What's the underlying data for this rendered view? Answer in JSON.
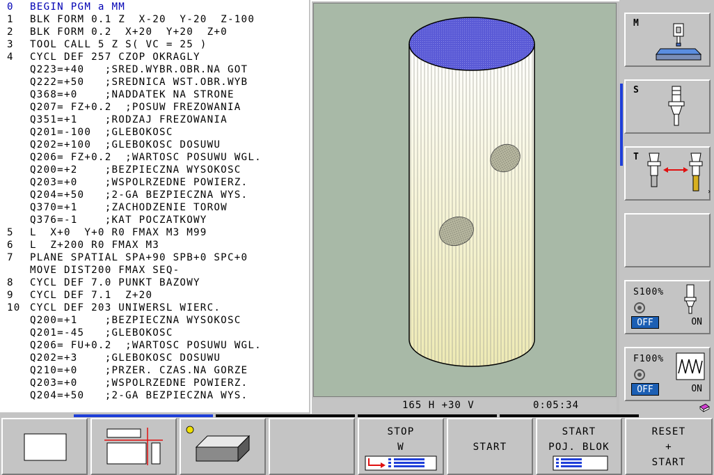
{
  "program": {
    "lines": [
      {
        "num": "0",
        "text": "BEGIN PGM a MM",
        "active": true
      },
      {
        "num": "1",
        "text": "BLK FORM 0.1 Z  X-20  Y-20  Z-100"
      },
      {
        "num": "2",
        "text": "BLK FORM 0.2  X+20  Y+20  Z+0"
      },
      {
        "num": "3",
        "text": "TOOL CALL 5 Z S( VC = 25 )"
      },
      {
        "num": "4",
        "text": "CYCL DEF 257 CZOP OKRAGLY"
      },
      {
        "num": "",
        "text": "Q223=+40   ;SRED.WYBR.OBR.NA GOT"
      },
      {
        "num": "",
        "text": "Q222=+50   ;SREDNICA WST.OBR.WYB"
      },
      {
        "num": "",
        "text": "Q368=+0    ;NADDATEK NA STRONE"
      },
      {
        "num": "",
        "text": "Q207= FZ+0.2  ;POSUW FREZOWANIA"
      },
      {
        "num": "",
        "text": "Q351=+1    ;RODZAJ FREZOWANIA"
      },
      {
        "num": "",
        "text": "Q201=-100  ;GLEBOKOSC"
      },
      {
        "num": "",
        "text": "Q202=+100  ;GLEBOKOSC DOSUWU"
      },
      {
        "num": "",
        "text": "Q206= FZ+0.2  ;WARTOSC POSUWU WGL."
      },
      {
        "num": "",
        "text": "Q200=+2    ;BEZPIECZNA WYSOKOSC"
      },
      {
        "num": "",
        "text": "Q203=+0    ;WSPOLRZEDNE POWIERZ."
      },
      {
        "num": "",
        "text": "Q204=+50   ;2-GA BEZPIECZNA WYS."
      },
      {
        "num": "",
        "text": "Q370=+1    ;ZACHODZENIE TOROW"
      },
      {
        "num": "",
        "text": "Q376=-1    ;KAT POCZATKOWY"
      },
      {
        "num": "5",
        "text": "L  X+0  Y+0 R0 FMAX M3 M99"
      },
      {
        "num": "6",
        "text": "L  Z+200 R0 FMAX M3"
      },
      {
        "num": "7",
        "text": "PLANE SPATIAL SPA+90 SPB+0 SPC+0"
      },
      {
        "num": "",
        "text": "MOVE DIST200 FMAX SEQ-"
      },
      {
        "num": "8",
        "text": "CYCL DEF 7.0 PUNKT BAZOWY"
      },
      {
        "num": "9",
        "text": "CYCL DEF 7.1  Z+20"
      },
      {
        "num": "10",
        "text": "CYCL DEF 203 UNIWERSL WIERC."
      },
      {
        "num": "",
        "text": "Q200=+1    ;BEZPIECZNA WYSOKOSC"
      },
      {
        "num": "",
        "text": "Q201=-45   ;GLEBOKOSC"
      },
      {
        "num": "",
        "text": "Q206= FU+0.2  ;WARTOSC POSUWU WGL."
      },
      {
        "num": "",
        "text": "Q202=+3    ;GLEBOKOSC DOSUWU"
      },
      {
        "num": "",
        "text": "Q210=+0    ;PRZER. CZAS.NA GORZE"
      },
      {
        "num": "",
        "text": "Q203=+0    ;WSPOLRZEDNE POWIERZ."
      },
      {
        "num": "",
        "text": "Q204=+50   ;2-GA BEZPIECZNA WYS."
      }
    ]
  },
  "graphics": {
    "view_info": "165 H +30 V",
    "elapsed_time": "0:05:34",
    "colors": {
      "background": "#a8b9a7",
      "top_face": "#5a5ad6",
      "cylinder_light": "#f2f0c0",
      "cylinder_dark": "#ffffff"
    }
  },
  "side_softkeys": {
    "machine": {
      "label": "M",
      "icon": "machine-table-icon"
    },
    "spindle": {
      "label": "S",
      "icon": "spindle-tool-icon"
    },
    "tool_change": {
      "label": "T",
      "icon": "tool-change-icon"
    },
    "spindle_override": {
      "label": "S100%",
      "off": "OFF",
      "on": "ON"
    },
    "feed_override": {
      "label": "F100%",
      "off": "OFF",
      "on": "ON"
    }
  },
  "bottom_softkeys": {
    "stop_w": {
      "line1": "STOP",
      "line2": "W"
    },
    "start": {
      "label": "START"
    },
    "start_block": {
      "line1": "START",
      "line2": "POJ. BLOK"
    },
    "reset_start": {
      "line1": "RESET",
      "line2": "+",
      "line3": "START"
    }
  },
  "accent_colors": {
    "active_line": "#0000b4",
    "indicator_blue": "#1f3fd8",
    "off_badge": "#1c5fb4"
  }
}
